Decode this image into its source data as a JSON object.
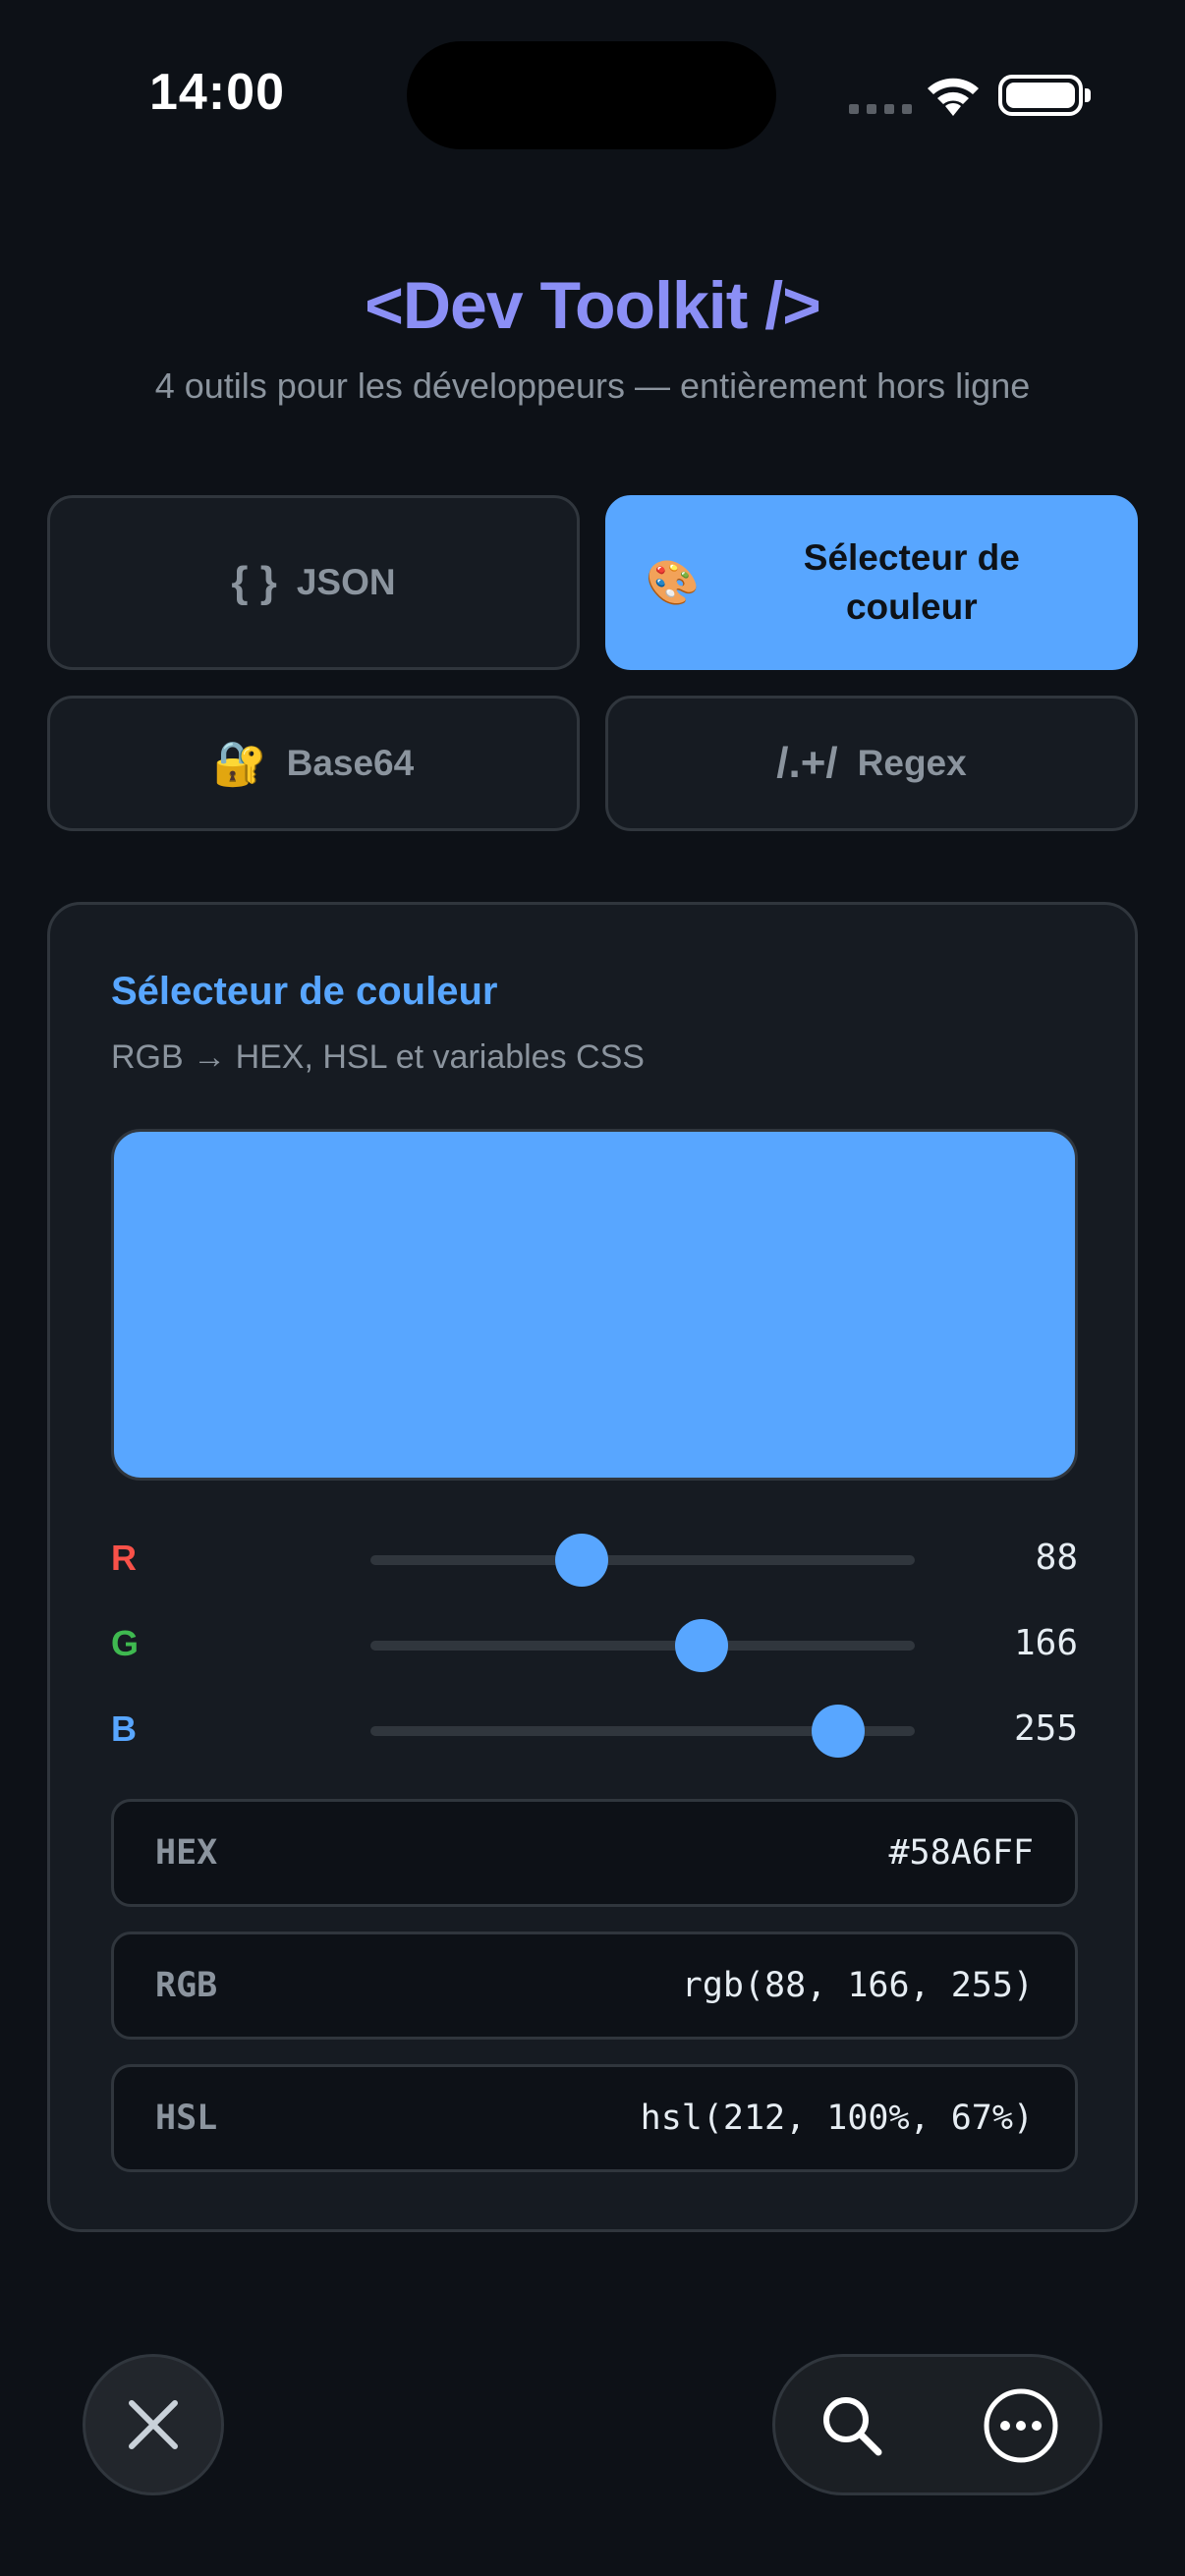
{
  "status_bar": {
    "time": "14:00"
  },
  "header": {
    "title": "<Dev Toolkit />",
    "subtitle": "4 outils pour les développeurs — entièrement hors ligne"
  },
  "tabs": [
    {
      "icon": "{ }",
      "label": "JSON",
      "active": false
    },
    {
      "icon": "🎨",
      "label": "Sélecteur de couleur",
      "active": true
    },
    {
      "icon": "🔐",
      "label": "Base64",
      "active": false
    },
    {
      "icon": "/.+/",
      "label": "Regex",
      "active": false
    }
  ],
  "card": {
    "title": "Sélecteur de couleur",
    "subtitle": "RGB → HEX, HSL et variables CSS",
    "swatch_color": "#58A6FF",
    "sliders": [
      {
        "channel": "R",
        "value": 88,
        "max": 255,
        "color": "#f85149"
      },
      {
        "channel": "G",
        "value": 166,
        "max": 255,
        "color": "#3fb950"
      },
      {
        "channel": "B",
        "value": 255,
        "max": 255,
        "color": "#58a6ff"
      }
    ],
    "outputs": [
      {
        "key": "HEX",
        "value": "#58A6FF"
      },
      {
        "key": "RGB",
        "value": "rgb(88, 166, 255)"
      },
      {
        "key": "HSL",
        "value": "hsl(212, 100%, 67%)"
      }
    ]
  },
  "bottom_bar": {
    "close_icon": "close-icon",
    "search_icon": "search-icon",
    "more_icon": "more-icon"
  },
  "colors": {
    "accent": "#58a6ff",
    "title": "#8b8ff5",
    "background": "#0d1117",
    "card": "#161b22",
    "border": "#30363d"
  }
}
